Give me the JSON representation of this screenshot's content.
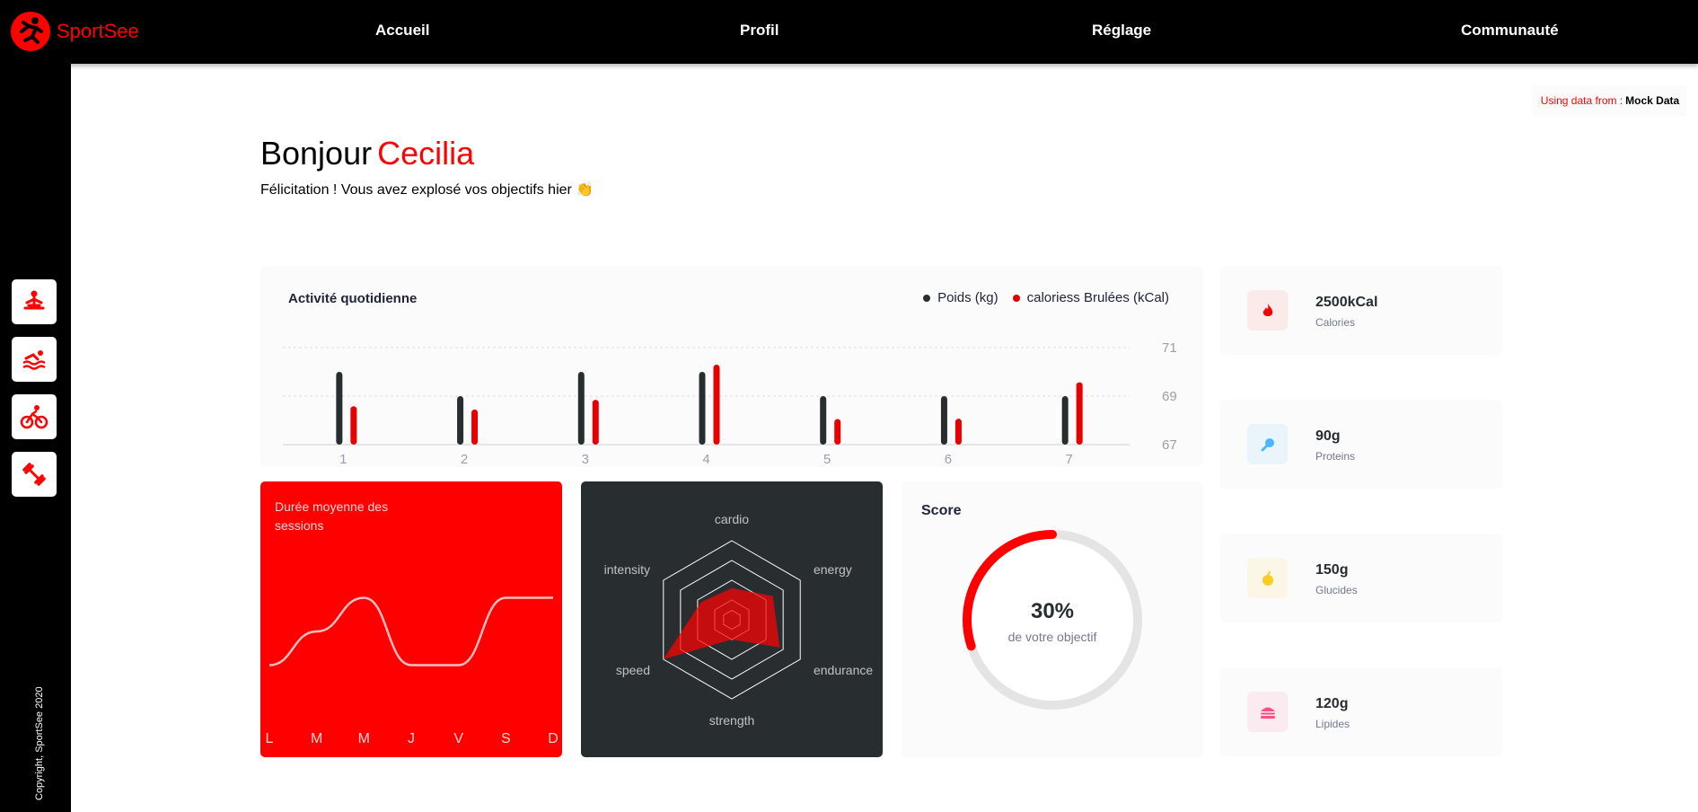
{
  "app": {
    "name": "SportSee",
    "brand_color": "#ff0101"
  },
  "nav": {
    "items": [
      "Accueil",
      "Profil",
      "Réglage",
      "Communauté"
    ]
  },
  "sidebar": {
    "icons": [
      "meditation-icon",
      "swimming-icon",
      "cycling-icon",
      "dumbbell-icon"
    ],
    "copyright": "Copyright, SportSee 2020"
  },
  "source": {
    "label": "Using data from :",
    "value": "Mock Data"
  },
  "greeting": {
    "hello": "Bonjour",
    "name": "Cecilia",
    "message": "Félicitation ! Vous avez explosé vos objectifs hier 👏"
  },
  "activity": {
    "title": "Activité quotidienne",
    "legend": {
      "weight": "Poids (kg)",
      "calories": "caloriess Brulées (kCal)"
    }
  },
  "sessions": {
    "title": "Durée moyenne des sessions"
  },
  "score": {
    "title": "Score",
    "value": "30%",
    "subtitle": "de votre objectif",
    "fraction": 0.3
  },
  "key_data": [
    {
      "value": "2500kCal",
      "label": "Calories",
      "icon": "fire-icon",
      "color": "#ff0000",
      "bg": "#fbeaea"
    },
    {
      "value": "90g",
      "label": "Proteins",
      "icon": "chicken-icon",
      "color": "#4ab8ff",
      "bg": "#e9f4fb"
    },
    {
      "value": "150g",
      "label": "Glucides",
      "icon": "apple-icon",
      "color": "#f9ce23",
      "bg": "#fbf6e5"
    },
    {
      "value": "120g",
      "label": "Lipides",
      "icon": "burger-icon",
      "color": "#fd5181",
      "bg": "#fbeaef"
    }
  ],
  "chart_data": [
    {
      "type": "bar",
      "title": "Activité quotidienne",
      "categories": [
        "1",
        "2",
        "3",
        "4",
        "5",
        "6",
        "7"
      ],
      "series": [
        {
          "name": "Poids (kg)",
          "axis": "right",
          "values": [
            70,
            69,
            70,
            70,
            69,
            69,
            69
          ],
          "color": "#282d30"
        },
        {
          "name": "caloriess Brulées (kCal)",
          "axis": "hidden",
          "values": [
            240,
            220,
            280,
            500,
            160,
            162,
            390
          ],
          "color": "#e60000"
        }
      ],
      "yticks": [
        67,
        69,
        71
      ],
      "ylim": [
        67,
        71
      ],
      "calories_lim": [
        0,
        500
      ],
      "grid": true,
      "legend": "top-right"
    },
    {
      "type": "line",
      "title": "Durée moyenne des sessions",
      "categories": [
        "L",
        "M",
        "M",
        "J",
        "V",
        "S",
        "D"
      ],
      "values": [
        30,
        40,
        50,
        30,
        30,
        50,
        50
      ]
    },
    {
      "type": "radar",
      "axes": [
        "cardio",
        "energy",
        "endurance",
        "strength",
        "speed",
        "intensity"
      ],
      "values": [
        80,
        120,
        140,
        50,
        200,
        90
      ],
      "max": 200
    },
    {
      "type": "pie",
      "title": "Score",
      "values": [
        30,
        70
      ]
    }
  ]
}
